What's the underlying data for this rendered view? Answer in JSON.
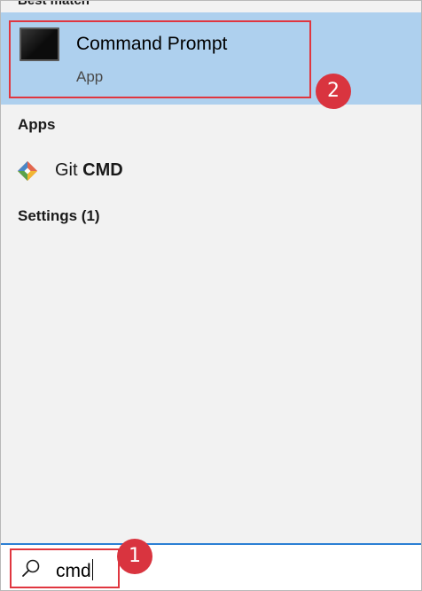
{
  "best_match": {
    "header_partial": "Best match",
    "app": {
      "title": "Command Prompt",
      "subtitle": "App",
      "icon": "command-prompt-icon"
    }
  },
  "apps": {
    "header": "Apps",
    "items": [
      {
        "label_prefix": "Git ",
        "label_bold": "CMD",
        "icon": "git-icon"
      }
    ]
  },
  "settings": {
    "header": "Settings (1)"
  },
  "search": {
    "value": "cmd",
    "icon": "search-icon"
  },
  "annotations": {
    "badge_1": "1",
    "badge_2": "2",
    "color": "#d9343f"
  },
  "colors": {
    "selection": "#aed0ee",
    "panel": "#f2f2f2",
    "search_border": "#2b7fd4"
  }
}
